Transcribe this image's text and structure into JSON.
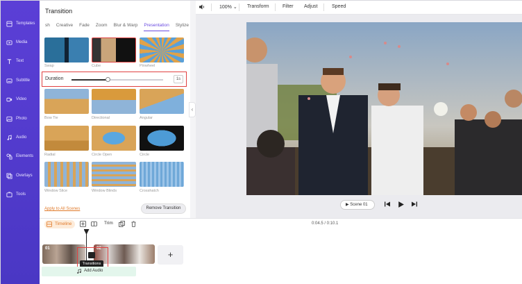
{
  "sidebar": {
    "items": [
      {
        "label": "Templates",
        "icon": "templates-icon"
      },
      {
        "label": "Media",
        "icon": "media-icon"
      },
      {
        "label": "Text",
        "icon": "text-icon"
      },
      {
        "label": "Subtitle",
        "icon": "subtitle-icon"
      },
      {
        "label": "Video",
        "icon": "video-icon"
      },
      {
        "label": "Photo",
        "icon": "photo-icon"
      },
      {
        "label": "Audio",
        "icon": "audio-icon"
      },
      {
        "label": "Elements",
        "icon": "elements-icon"
      },
      {
        "label": "Overlays",
        "icon": "overlays-icon"
      },
      {
        "label": "Tools",
        "icon": "tools-icon"
      }
    ]
  },
  "panel": {
    "title": "Transition",
    "categories": [
      "sh",
      "Creative",
      "Fade",
      "Zoom",
      "Blur & Warp",
      "Presentation",
      "Stylize"
    ],
    "active_category": "Presentation",
    "thumbnails": [
      {
        "label": "Swap"
      },
      {
        "label": "Cube"
      },
      {
        "label": "Pinwheel"
      },
      {
        "label": "Bow Tie"
      },
      {
        "label": "Directional"
      },
      {
        "label": "Angular"
      },
      {
        "label": "Radial"
      },
      {
        "label": "Circle Open"
      },
      {
        "label": "Circle"
      },
      {
        "label": "Window Slice"
      },
      {
        "label": "Window Blinds"
      },
      {
        "label": "Crosshatch"
      }
    ],
    "selected_thumbnail": "Cube",
    "duration": {
      "label": "Duration",
      "value": "1s",
      "slider_fraction": 0.4
    },
    "apply_all": "Apply to All Scenes",
    "remove": "Remove Transition"
  },
  "toolbar": {
    "volume_icon": "volume-icon",
    "zoom": "100%",
    "transform": "Transform",
    "filter": "Filter",
    "adjust": "Adjust",
    "speed": "Speed"
  },
  "player": {
    "scene": "Scene 01"
  },
  "timeline": {
    "label": "Timeline",
    "trim": "Trim",
    "time": "0:04.5 / 0:10.1",
    "clip1": "01",
    "clip2": "02",
    "tooltip": "Transitions",
    "add": "+",
    "add_audio": "Add Audio"
  },
  "colors": {
    "sidebar": "#5b3fd6",
    "accent": "#6a4be0",
    "highlight": "#e04040",
    "timeline_accent": "#e07a2a"
  }
}
